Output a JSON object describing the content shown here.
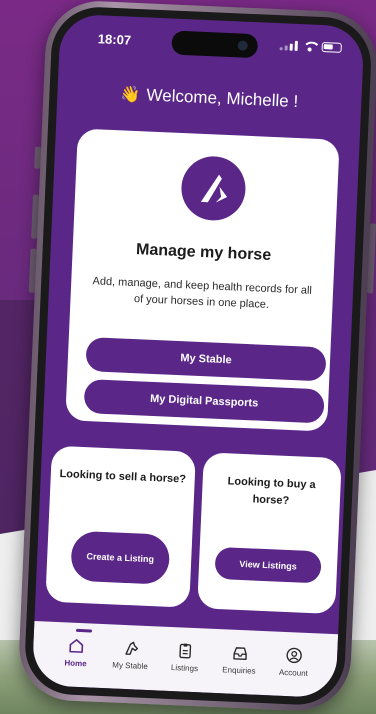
{
  "status_bar": {
    "time": "18:07"
  },
  "header": {
    "wave_emoji": "👋",
    "welcome": "Welcome, Michelle !"
  },
  "manage_card": {
    "title": "Manage my horse",
    "description": "Add, manage, and keep health records for all of your horses in one place.",
    "buttons": {
      "stable": "My Stable",
      "passports": "My Digital Passports"
    }
  },
  "sell_card": {
    "title": "Looking to sell a horse?",
    "button": "Create a Listing"
  },
  "buy_card": {
    "title": "Looking to buy a horse?",
    "button": "View Listings"
  },
  "tab_bar": {
    "tabs": [
      {
        "label": "Home",
        "icon": "home-icon",
        "active": true
      },
      {
        "label": "My Stable",
        "icon": "horse-icon",
        "active": false
      },
      {
        "label": "Listings",
        "icon": "clipboard-icon",
        "active": false
      },
      {
        "label": "Enquiries",
        "icon": "inbox-icon",
        "active": false
      },
      {
        "label": "Account",
        "icon": "account-icon",
        "active": false
      }
    ]
  },
  "colors": {
    "brand_purple": "#5a2789",
    "card_bg": "#ffffff",
    "tab_bg": "#f6f4f8"
  }
}
